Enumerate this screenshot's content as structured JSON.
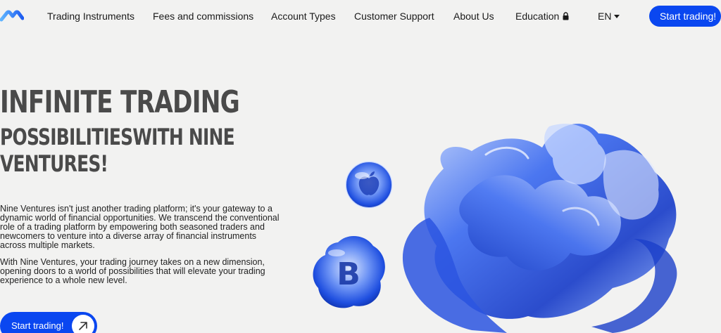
{
  "nav": {
    "items": [
      {
        "label": "Trading Instruments"
      },
      {
        "label": "Fees and commissions"
      },
      {
        "label": "Account Types"
      },
      {
        "label": "Customer Support"
      },
      {
        "label": "About Us"
      },
      {
        "label": "Education"
      }
    ],
    "lang": "EN",
    "cta": "Start trading!"
  },
  "hero": {
    "line1": "INFINITE TRADING",
    "line2": "POSSIBILITIESWITH NINE",
    "line3": "VENTURES!",
    "para1": "Nine Ventures isn't just another trading platform; it's your gateway to a dynamic world of financial opportunities. We transcend the conventional role of a trading platform by empowering both seasoned traders and newcomers to venture into a diverse array of financial instruments across multiple markets.",
    "para2": "With Nine Ventures, your trading journey takes on a new dimension, opening doors to a world of possibilities that will elevate your trading experience to a whole new level.",
    "cta": "Start trading!",
    "bitcoin_glyph": "B"
  },
  "colors": {
    "accent": "#0a47f0",
    "background": "#f2f2f1",
    "headline": "#4a4a4a"
  },
  "icons": [
    "logo-icon",
    "lock-icon",
    "caret-down-icon",
    "arrow-up-right-icon",
    "apple-icon",
    "bitcoin-icon"
  ]
}
